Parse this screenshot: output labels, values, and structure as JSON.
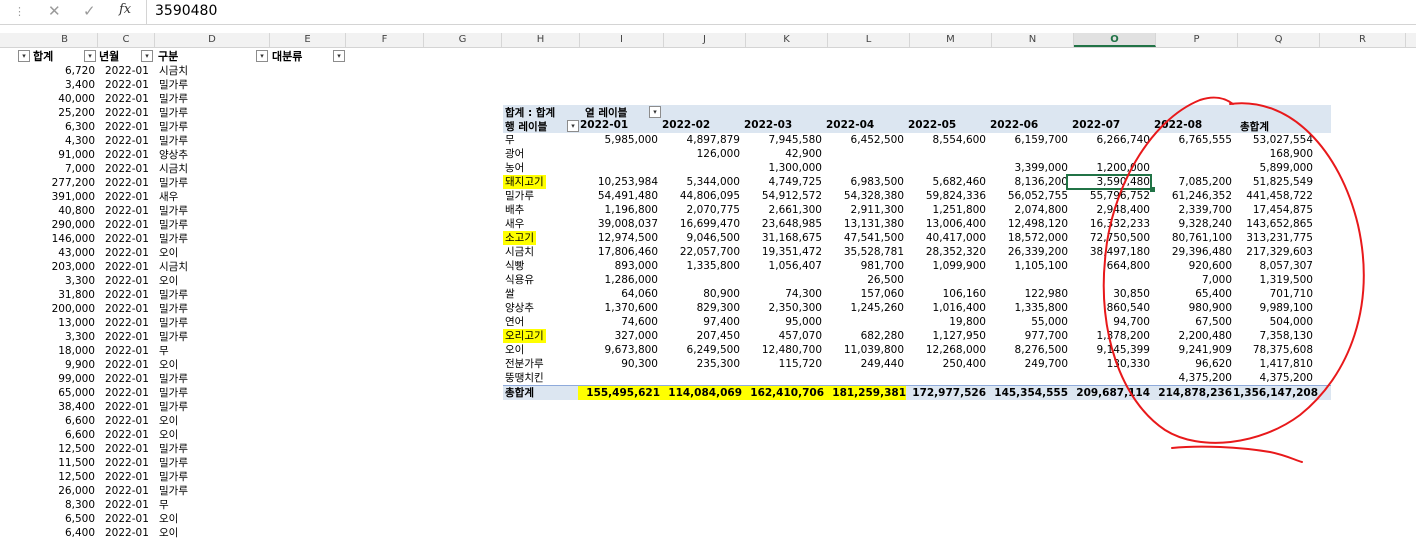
{
  "formula_bar": {
    "dots": "⋮",
    "cancel_glyph": "✕",
    "confirm_glyph": "✓",
    "fx_label": "fx",
    "value": "3590480"
  },
  "columns": [
    "B",
    "C",
    "D",
    "E",
    "F",
    "G",
    "H",
    "I",
    "J",
    "K",
    "L",
    "M",
    "N",
    "O",
    "P",
    "Q",
    "R"
  ],
  "selected_column": "O",
  "left_table": {
    "headers": {
      "b": "합계",
      "c": "년월",
      "g": "구분",
      "e": "대분류"
    },
    "rows": [
      [
        "6,720",
        "2022-01",
        "시금치"
      ],
      [
        "3,400",
        "2022-01",
        "밀가루"
      ],
      [
        "40,000",
        "2022-01",
        "밀가루"
      ],
      [
        "25,200",
        "2022-01",
        "밀가루"
      ],
      [
        "6,300",
        "2022-01",
        "밀가루"
      ],
      [
        "4,300",
        "2022-01",
        "밀가루"
      ],
      [
        "91,000",
        "2022-01",
        "양상추"
      ],
      [
        "7,000",
        "2022-01",
        "시금치"
      ],
      [
        "277,200",
        "2022-01",
        "밀가루"
      ],
      [
        "391,000",
        "2022-01",
        "새우"
      ],
      [
        "40,800",
        "2022-01",
        "밀가루"
      ],
      [
        "290,000",
        "2022-01",
        "밀가루"
      ],
      [
        "146,000",
        "2022-01",
        "밀가루"
      ],
      [
        "43,000",
        "2022-01",
        "오이"
      ],
      [
        "203,000",
        "2022-01",
        "시금치"
      ],
      [
        "3,300",
        "2022-01",
        "오이"
      ],
      [
        "31,800",
        "2022-01",
        "밀가루"
      ],
      [
        "200,000",
        "2022-01",
        "밀가루"
      ],
      [
        "13,000",
        "2022-01",
        "밀가루"
      ],
      [
        "3,300",
        "2022-01",
        "밀가루"
      ],
      [
        "18,000",
        "2022-01",
        "무"
      ],
      [
        "9,900",
        "2022-01",
        "오이"
      ],
      [
        "99,000",
        "2022-01",
        "밀가루"
      ],
      [
        "65,000",
        "2022-01",
        "밀가루"
      ],
      [
        "38,400",
        "2022-01",
        "밀가루"
      ],
      [
        "6,600",
        "2022-01",
        "오이"
      ],
      [
        "6,600",
        "2022-01",
        "오이"
      ],
      [
        "12,500",
        "2022-01",
        "밀가루"
      ],
      [
        "11,500",
        "2022-01",
        "밀가루"
      ],
      [
        "12,500",
        "2022-01",
        "밀가루"
      ],
      [
        "26,000",
        "2022-01",
        "밀가루"
      ],
      [
        "8,300",
        "2022-01",
        "무"
      ],
      [
        "6,500",
        "2022-01",
        "오이"
      ],
      [
        "6,400",
        "2022-01",
        "오이"
      ]
    ]
  },
  "pivot": {
    "title_label": "합계 : 합계",
    "col_labels_label": "열 레이블",
    "row_labels_label": "행 레이블",
    "months": [
      "2022-01",
      "2022-02",
      "2022-03",
      "2022-04",
      "2022-05",
      "2022-06",
      "2022-07",
      "2022-08"
    ],
    "grand_total_label": "총합계",
    "rows": [
      {
        "label": "무",
        "hl": false,
        "v": [
          "5,985,000",
          "4,897,879",
          "7,945,580",
          "6,452,500",
          "8,554,600",
          "6,159,700",
          "6,266,740",
          "6,765,555",
          "53,027,554"
        ]
      },
      {
        "label": "광어",
        "hl": false,
        "v": [
          "",
          "126,000",
          "42,900",
          "",
          "",
          "",
          "",
          "",
          "168,900"
        ]
      },
      {
        "label": "농어",
        "hl": false,
        "v": [
          "",
          "",
          "1,300,000",
          "",
          "",
          "3,399,000",
          "1,200,000",
          "",
          "5,899,000"
        ]
      },
      {
        "label": "돼지고기",
        "hl": true,
        "v": [
          "10,253,984",
          "5,344,000",
          "4,749,725",
          "6,983,500",
          "5,682,460",
          "8,136,200",
          "3,590,480",
          "7,085,200",
          "51,825,549"
        ]
      },
      {
        "label": "밀가루",
        "hl": false,
        "v": [
          "54,491,480",
          "44,806,095",
          "54,912,572",
          "54,328,380",
          "59,824,336",
          "56,052,755",
          "55,796,752",
          "61,246,352",
          "441,458,722"
        ]
      },
      {
        "label": "배추",
        "hl": false,
        "v": [
          "1,196,800",
          "2,070,775",
          "2,661,300",
          "2,911,300",
          "1,251,800",
          "2,074,800",
          "2,948,400",
          "2,339,700",
          "17,454,875"
        ]
      },
      {
        "label": "새우",
        "hl": false,
        "v": [
          "39,008,037",
          "16,699,470",
          "23,648,985",
          "13,131,380",
          "13,006,400",
          "12,498,120",
          "16,332,233",
          "9,328,240",
          "143,652,865"
        ]
      },
      {
        "label": "소고기",
        "hl": true,
        "v": [
          "12,974,500",
          "9,046,500",
          "31,168,675",
          "47,541,500",
          "40,417,000",
          "18,572,000",
          "72,750,500",
          "80,761,100",
          "313,231,775"
        ]
      },
      {
        "label": "시금치",
        "hl": false,
        "v": [
          "17,806,460",
          "22,057,700",
          "19,351,472",
          "35,528,781",
          "28,352,320",
          "26,339,200",
          "38,497,180",
          "29,396,480",
          "217,329,603"
        ]
      },
      {
        "label": "식빵",
        "hl": false,
        "v": [
          "893,000",
          "1,335,800",
          "1,056,407",
          "981,700",
          "1,099,900",
          "1,105,100",
          "664,800",
          "920,600",
          "8,057,307"
        ]
      },
      {
        "label": "식용유",
        "hl": false,
        "v": [
          "1,286,000",
          "",
          "",
          "26,500",
          "",
          "",
          "",
          "7,000",
          "1,319,500"
        ]
      },
      {
        "label": "쌀",
        "hl": false,
        "v": [
          "64,060",
          "80,900",
          "74,300",
          "157,060",
          "106,160",
          "122,980",
          "30,850",
          "65,400",
          "701,710"
        ]
      },
      {
        "label": "양상추",
        "hl": false,
        "v": [
          "1,370,600",
          "829,300",
          "2,350,300",
          "1,245,260",
          "1,016,400",
          "1,335,800",
          "860,540",
          "980,900",
          "9,989,100"
        ]
      },
      {
        "label": "연어",
        "hl": false,
        "v": [
          "74,600",
          "97,400",
          "95,000",
          "",
          "19,800",
          "55,000",
          "94,700",
          "67,500",
          "504,000"
        ]
      },
      {
        "label": "오리고기",
        "hl": true,
        "v": [
          "327,000",
          "207,450",
          "457,070",
          "682,280",
          "1,127,950",
          "977,700",
          "1,378,200",
          "2,200,480",
          "7,358,130"
        ]
      },
      {
        "label": "오이",
        "hl": false,
        "v": [
          "9,673,800",
          "6,249,500",
          "12,480,700",
          "11,039,800",
          "12,268,000",
          "8,276,500",
          "9,145,399",
          "9,241,909",
          "78,375,608"
        ]
      },
      {
        "label": "전분가루",
        "hl": false,
        "v": [
          "90,300",
          "235,300",
          "115,720",
          "249,440",
          "250,400",
          "249,700",
          "130,330",
          "96,620",
          "1,417,810"
        ]
      },
      {
        "label": "뚱땡치킨",
        "hl": false,
        "v": [
          "",
          "",
          "",
          "",
          "",
          "",
          "",
          "4,375,200",
          "4,375,200"
        ]
      }
    ],
    "total": {
      "label": "총합계",
      "v": [
        "155,495,621",
        "114,084,069",
        "162,410,706",
        "181,259,381",
        "172,977,526",
        "145,354,555",
        "209,687,114",
        "214,878,236",
        "1,356,147,208"
      ],
      "hl": [
        true,
        true,
        true,
        true,
        false,
        false,
        false,
        false,
        false
      ]
    }
  },
  "annotation_color": "#e8191b",
  "accent_color": "#217346"
}
